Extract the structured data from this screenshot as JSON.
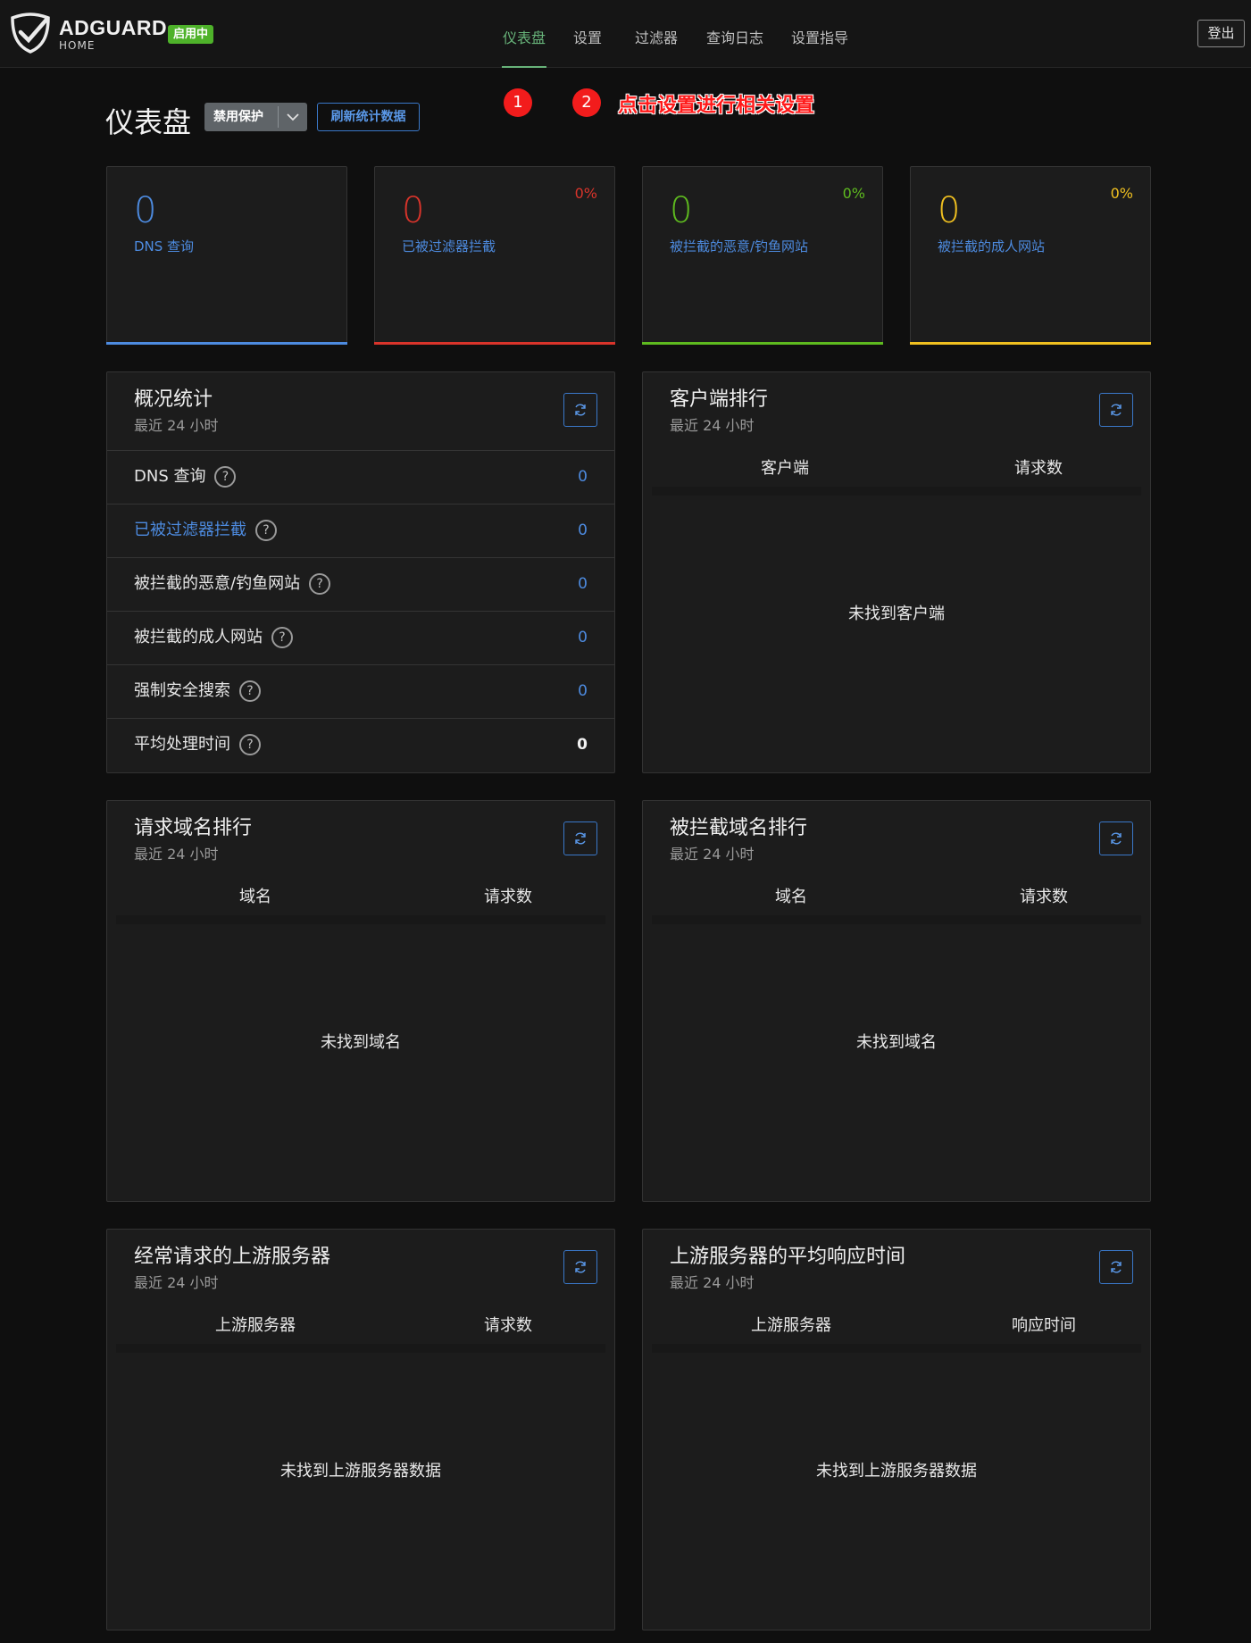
{
  "header": {
    "brand": "ADGUARD",
    "brand_sub": "HOME",
    "status": "启用中",
    "nav": [
      "仪表盘",
      "设置",
      "过滤器",
      "查询日志",
      "设置指导"
    ],
    "logout": "登出"
  },
  "toolbar": {
    "title": "仪表盘",
    "disable_label": "禁用保护",
    "refresh_label": "刷新统计数据"
  },
  "annotation": {
    "step1": "1",
    "step2": "2",
    "text": "点击设置进行相关设置",
    "color": "#f21c1c"
  },
  "cards": [
    {
      "value": "0",
      "label": "DNS 查询",
      "pct": "",
      "color": "#4d8be0"
    },
    {
      "value": "0",
      "label": "已被过滤器拦截",
      "pct": "0%",
      "color": "#d9342b"
    },
    {
      "value": "0",
      "label": "被拦截的恶意/钓鱼网站",
      "pct": "0%",
      "color": "#5eba1f"
    },
    {
      "value": "0",
      "label": "被拦截的成人网站",
      "pct": "0%",
      "color": "#f0c020"
    }
  ],
  "overview": {
    "title": "概况统计",
    "subtitle": "最近 24 小时",
    "rows": [
      {
        "label": "DNS 查询",
        "value": "0"
      },
      {
        "label": "已被过滤器拦截",
        "value": "0"
      },
      {
        "label": "被拦截的恶意/钓鱼网站",
        "value": "0"
      },
      {
        "label": "被拦截的成人网站",
        "value": "0"
      },
      {
        "label": "强制安全搜索",
        "value": "0"
      },
      {
        "label": "平均处理时间",
        "value": "0"
      }
    ]
  },
  "clients": {
    "title": "客户端排行",
    "subtitle": "最近 24 小时",
    "col1": "客户端",
    "col2": "请求数",
    "empty": "未找到客户端"
  },
  "queried": {
    "title": "请求域名排行",
    "subtitle": "最近 24 小时",
    "col1": "域名",
    "col2": "请求数",
    "empty": "未找到域名"
  },
  "blocked": {
    "title": "被拦截域名排行",
    "subtitle": "最近 24 小时",
    "col1": "域名",
    "col2": "请求数",
    "empty": "未找到域名"
  },
  "upstreams": {
    "title": "经常请求的上游服务器",
    "subtitle": "最近 24 小时",
    "col1": "上游服务器",
    "col2": "请求数",
    "empty": "未找到上游服务器数据"
  },
  "upstream_time": {
    "title": "上游服务器的平均响应时间",
    "subtitle": "最近 24 小时",
    "col1": "上游服务器",
    "col2": "响应时间",
    "empty": "未找到上游服务器数据"
  },
  "help_glyph": "?",
  "icons": {
    "logo": "adguard-shield-icon",
    "refresh": "refresh-icon",
    "chevron": "chevron-down-icon",
    "help": "help-circle-icon"
  }
}
